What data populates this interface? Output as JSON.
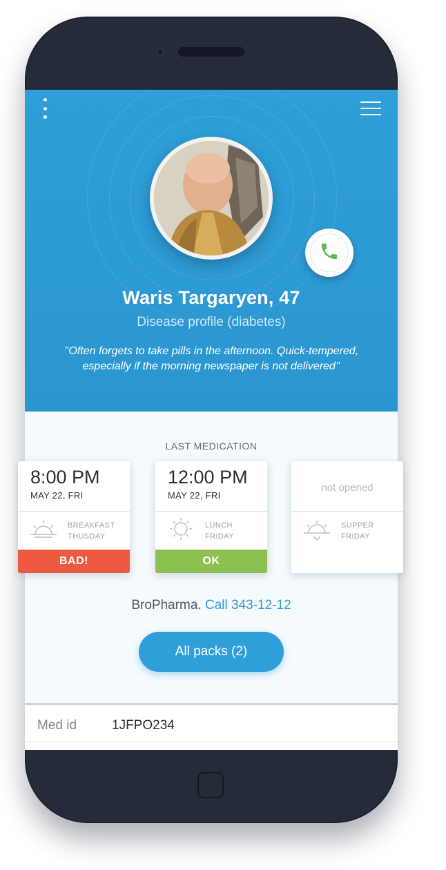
{
  "patient": {
    "name": "Waris Targaryen, 47",
    "disease_profile": "Disease profile (diabetes)",
    "quote": "’’Often forgets to take pills in the afternoon. Quick-tempered, especially if the morning newspaper is not delivered’’"
  },
  "section": {
    "last_medication": "LAST MEDICATION"
  },
  "cards": [
    {
      "time": "8:00 PM",
      "date": "MAY 22, FRI",
      "meal": "BREAKFAST",
      "day": "THUSDAY",
      "status": "BAD!",
      "status_color": "#ee5a40"
    },
    {
      "time": "12:00 PM",
      "date": "MAY 22, FRI",
      "meal": "LUNCH",
      "day": "FRIDAY",
      "status": "OK",
      "status_color": "#8cc152"
    },
    {
      "status_text": "not opened",
      "meal": "SUPPER",
      "day": "FRIDAY"
    }
  ],
  "pharmacy": {
    "name": "BroPharma.",
    "call_label": "Call 343-12-12"
  },
  "buttons": {
    "all_packs": "All packs (2)"
  },
  "med": {
    "label": "Med id",
    "value": "1JFPO234"
  },
  "icons": {
    "menu": "vertical-dots-icon",
    "nav": "hamburger-icon",
    "call": "phone-icon",
    "breakfast": "sunrise-icon",
    "lunch": "sun-icon",
    "supper": "sunset-icon"
  },
  "colors": {
    "primary": "#2f9fd9",
    "bad": "#ee5a40",
    "ok": "#8cc152",
    "phone_green": "#5cb85c"
  }
}
